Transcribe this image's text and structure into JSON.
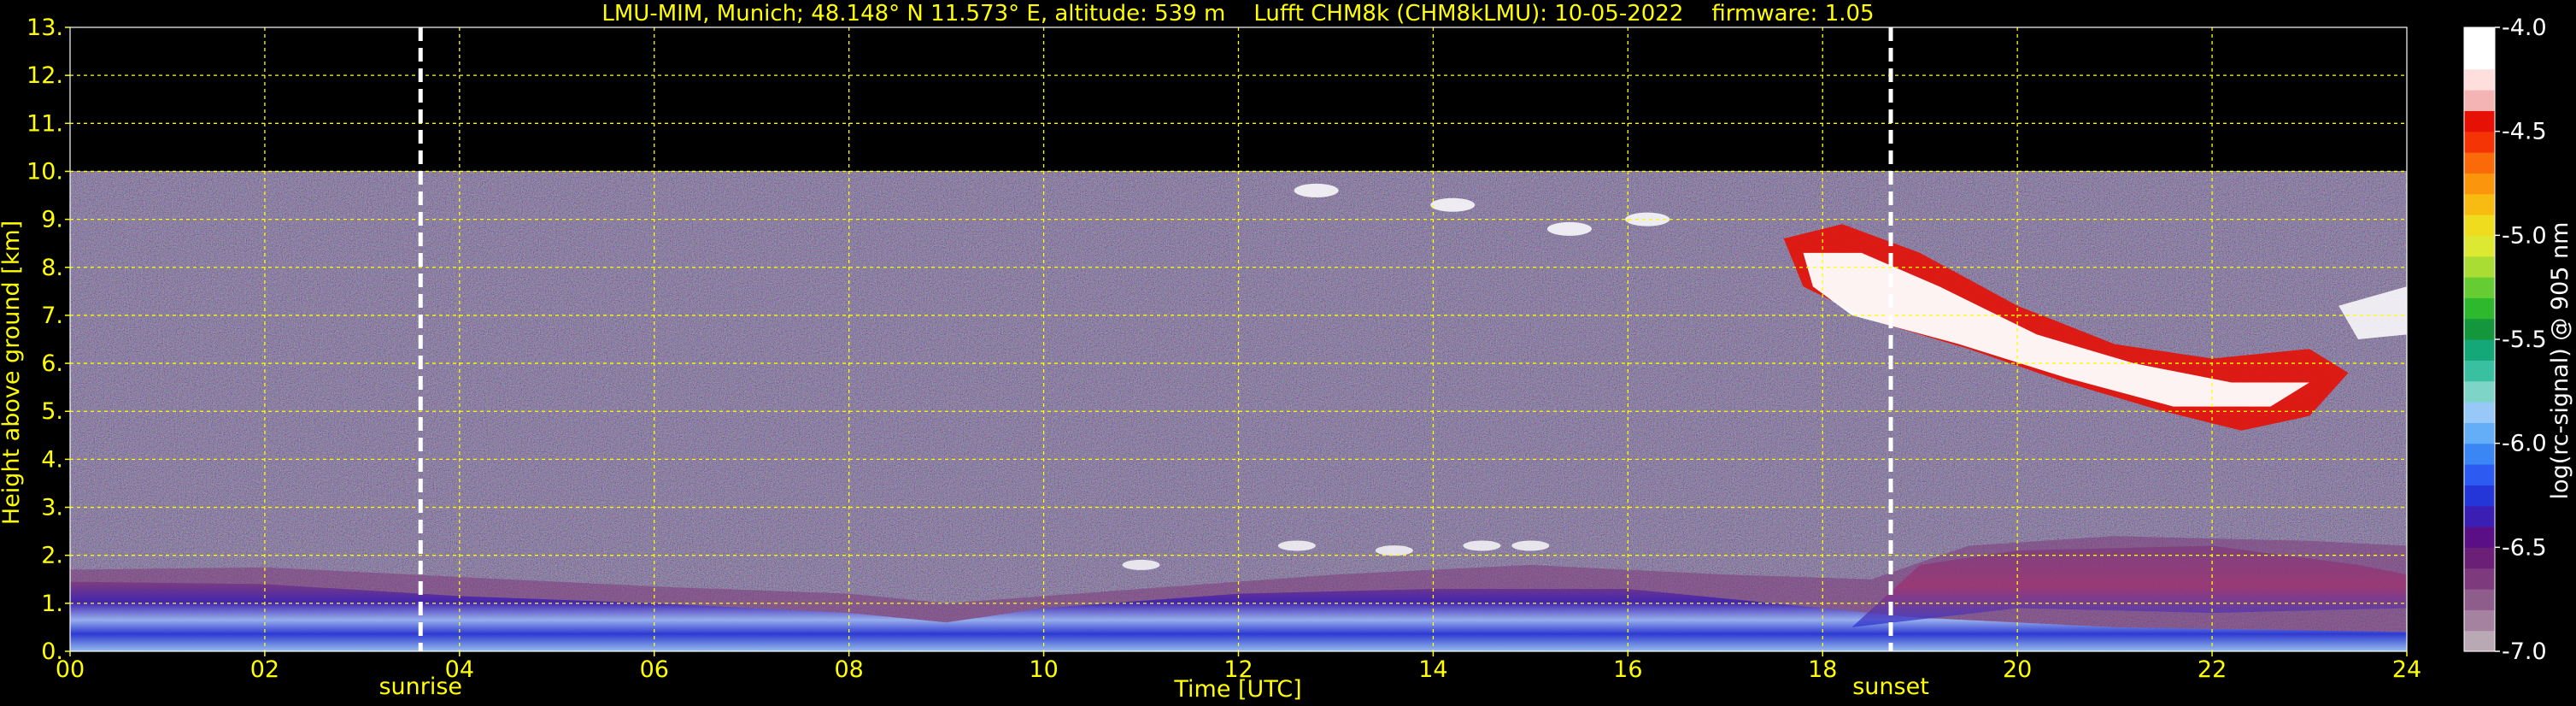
{
  "header": {
    "title": "LMU-MIM, Munich; 48.148° N 11.573° E, altitude: 539 m    Lufft CHM8k (CHM8kLMU): 10-05-2022    firmware: 1.05"
  },
  "chart_data": {
    "type": "heatmap",
    "title": "LMU-MIM, Munich; 48.148° N 11.573° E, altitude: 539 m    Lufft CHM8k (CHM8kLMU): 10-05-2022    firmware: 1.05",
    "xlabel": "Time [UTC]",
    "ylabel": "Height above ground [km]",
    "xlim": [
      0,
      24
    ],
    "ylim": [
      0,
      13
    ],
    "x_ticks": [
      "00",
      "02",
      "04",
      "06",
      "08",
      "10",
      "12",
      "14",
      "16",
      "18",
      "20",
      "22",
      "24"
    ],
    "y_ticks": [
      "0.",
      "1.",
      "2.",
      "3.",
      "4.",
      "5.",
      "6.",
      "7.",
      "8.",
      "9.",
      "10.",
      "11.",
      "12.",
      "13."
    ],
    "grid": true,
    "grid_color": "#ffff00",
    "background": "#000000",
    "data_ceiling_km": 10,
    "markers": [
      {
        "label": "sunrise",
        "x": 3.6
      },
      {
        "label": "sunset",
        "x": 18.7
      }
    ],
    "colorbar": {
      "label": "log(rc-signal) @ 905 nm",
      "range": [
        -7.0,
        -4.0
      ],
      "tick_labels": [
        "-7.0",
        "-6.5",
        "-6.0",
        "-5.5",
        "-5.0",
        "-4.5",
        "-4.0"
      ],
      "colors": [
        "#b9a9b4",
        "#a583a0",
        "#8f5d8c",
        "#7d3a7c",
        "#6b1f76",
        "#5a0f86",
        "#3b1fb4",
        "#2436d8",
        "#2d5af0",
        "#3a86f5",
        "#64aef7",
        "#98c8f8",
        "#7fd4c8",
        "#38c0a0",
        "#14a878",
        "#14963c",
        "#2eb82e",
        "#66cc33",
        "#aadd33",
        "#dde833",
        "#f0dc1e",
        "#f8bb12",
        "#fb960c",
        "#fb6a08",
        "#f53406",
        "#e61005",
        "#f4b4b4",
        "#ffdede",
        "#ffffff",
        "#ffffff"
      ]
    }
  },
  "colors": {
    "axis_text": "#ffff00",
    "colorbar_text": "#ffffff"
  }
}
